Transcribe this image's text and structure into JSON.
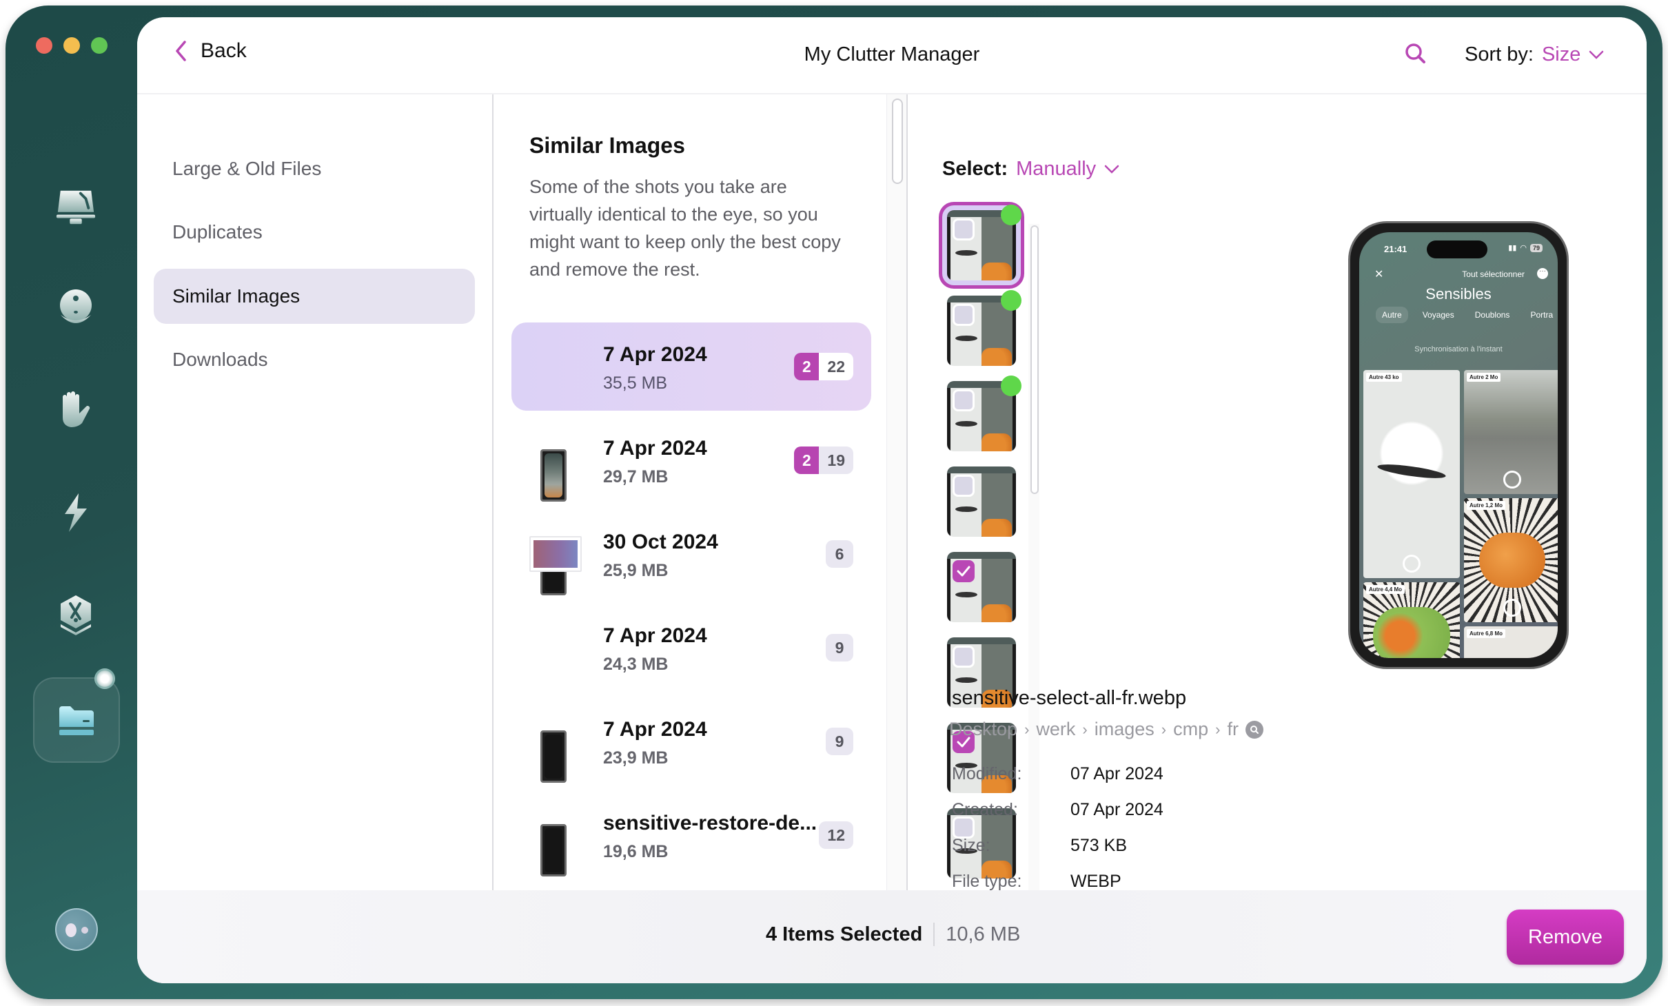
{
  "window_controls": [
    "close",
    "minimize",
    "zoom"
  ],
  "rail": {
    "items": [
      {
        "name": "cleanup",
        "icon": "monitor-broom-icon"
      },
      {
        "name": "protection",
        "icon": "shield-disc-icon"
      },
      {
        "name": "privacy",
        "icon": "hand-icon"
      },
      {
        "name": "performance",
        "icon": "lightning-icon"
      },
      {
        "name": "applications",
        "icon": "apps-hexagon-icon"
      },
      {
        "name": "my-clutter",
        "icon": "folder-drive-icon",
        "active": true
      }
    ],
    "assistant_icon": "assistant-eyes-icon"
  },
  "header": {
    "back_label": "Back",
    "title": "My Clutter Manager",
    "sort_label": "Sort by:",
    "sort_value": "Size"
  },
  "nav": {
    "items": [
      {
        "label": "Large & Old Files",
        "active": false
      },
      {
        "label": "Duplicates",
        "active": false
      },
      {
        "label": "Similar Images",
        "active": true
      },
      {
        "label": "Downloads",
        "active": false
      }
    ]
  },
  "list": {
    "title": "Similar Images",
    "description": "Some of the shots you take are virtually identical to the eye, so you might want to keep only the best copy and remove the rest.",
    "groups": [
      {
        "title": "7 Apr 2024",
        "size": "35,5 MB",
        "selected_count": "2",
        "total_count": "22",
        "thumb": "phone-light",
        "selected": true
      },
      {
        "title": "7 Apr 2024",
        "size": "29,7 MB",
        "selected_count": "2",
        "total_count": "19",
        "thumb": "phone-dark",
        "selected": false
      },
      {
        "title": "30 Oct 2024",
        "size": "25,9 MB",
        "selected_count": null,
        "total_count": "6",
        "thumb": "landscape",
        "selected": false
      },
      {
        "title": "7 Apr 2024",
        "size": "24,3 MB",
        "selected_count": null,
        "total_count": "9",
        "thumb": "phone-dark",
        "selected": false
      },
      {
        "title": "7 Apr 2024",
        "size": "23,9 MB",
        "selected_count": null,
        "total_count": "9",
        "thumb": "phone-dark",
        "selected": false
      },
      {
        "title": "sensitive-restore-de...",
        "size": "19,6 MB",
        "selected_count": null,
        "total_count": "12",
        "thumb": "phone-grey",
        "selected": false
      }
    ]
  },
  "detail": {
    "select_label": "Select:",
    "select_value": "Manually",
    "thumbnails": [
      {
        "checked": false,
        "best": true,
        "focused": true
      },
      {
        "checked": false,
        "best": true,
        "focused": false
      },
      {
        "checked": false,
        "best": true,
        "focused": false
      },
      {
        "checked": false,
        "best": false,
        "focused": false
      },
      {
        "checked": true,
        "best": false,
        "focused": false
      },
      {
        "checked": false,
        "best": false,
        "focused": false
      },
      {
        "checked": true,
        "best": false,
        "focused": false
      },
      {
        "checked": false,
        "best": false,
        "focused": false
      }
    ],
    "preview": {
      "time": "21:41",
      "battery": "79",
      "select_all": "Tout sélectionner",
      "title": "Sensibles",
      "tabs": [
        "Autre",
        "Voyages",
        "Doublons",
        "Portra"
      ],
      "sync": "Synchronisation à l'instant",
      "tiles": [
        "Autre 43 ko",
        "Autre 2 Mo",
        "Autre 1,2 Mo",
        "Autre 4,4 Mo",
        "Autre 6,8 Mo"
      ]
    },
    "file_name": "sensitive-select-all-fr.webp",
    "path": [
      "Desktop",
      "werk",
      "images",
      "cmp",
      "fr"
    ],
    "meta": [
      {
        "key": "Modified:",
        "value": "07 Apr 2024"
      },
      {
        "key": "Created:",
        "value": "07 Apr 2024"
      },
      {
        "key": "Size:",
        "value": "573 KB"
      },
      {
        "key": "File type:",
        "value": "WEBP"
      }
    ]
  },
  "footer": {
    "selected_count": "4 Items Selected",
    "selected_size": "10,6 MB",
    "remove_label": "Remove"
  },
  "colors": {
    "accent": "#b847b4",
    "remove_button": "#c834b6",
    "best_indicator": "#5fd74a",
    "frame": "#234f4d"
  }
}
